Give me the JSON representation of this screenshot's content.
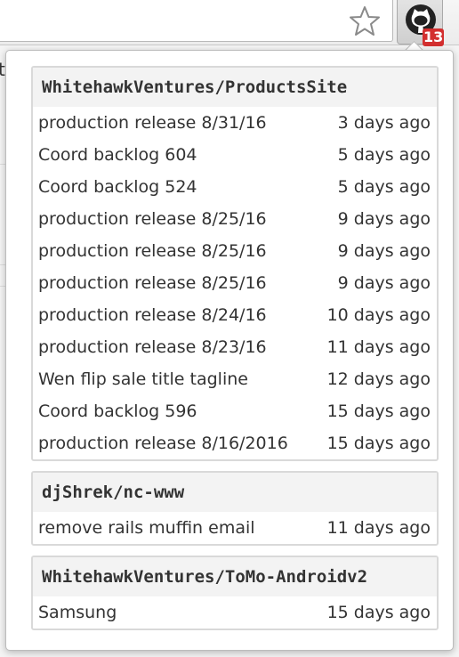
{
  "badge": {
    "count": "13"
  },
  "background": {
    "glyph": "t"
  },
  "repos": [
    {
      "name": "WhitehawkVentures/ProductsSite",
      "items": [
        {
          "title": "production release 8/31/16",
          "time": "3 days ago"
        },
        {
          "title": "Coord backlog 604",
          "time": "5 days ago"
        },
        {
          "title": "Coord backlog 524",
          "time": "5 days ago"
        },
        {
          "title": "production release 8/25/16",
          "time": "9 days ago"
        },
        {
          "title": "production release 8/25/16",
          "time": "9 days ago"
        },
        {
          "title": "production release 8/25/16",
          "time": "9 days ago"
        },
        {
          "title": "production release 8/24/16",
          "time": "10 days ago"
        },
        {
          "title": "production release 8/23/16",
          "time": "11 days ago"
        },
        {
          "title": "Wen flip sale title tagline",
          "time": "12 days ago"
        },
        {
          "title": "Coord backlog 596",
          "time": "15 days ago"
        },
        {
          "title": "production release 8/16/2016",
          "time": "15 days ago"
        }
      ]
    },
    {
      "name": "djShrek/nc-www",
      "items": [
        {
          "title": "remove rails muffin email",
          "time": "11 days ago"
        }
      ]
    },
    {
      "name": "WhitehawkVentures/ToMo-Androidv2",
      "items": [
        {
          "title": "Samsung",
          "time": "15 days ago"
        }
      ]
    }
  ],
  "colors": {
    "badge": "#d32f2f",
    "text": "#333333",
    "repo_header_bg": "#f3f3f3",
    "repo_border": "#d9d9d9"
  },
  "icons": {
    "bookmark": "star-icon",
    "extension": "github-icon"
  }
}
